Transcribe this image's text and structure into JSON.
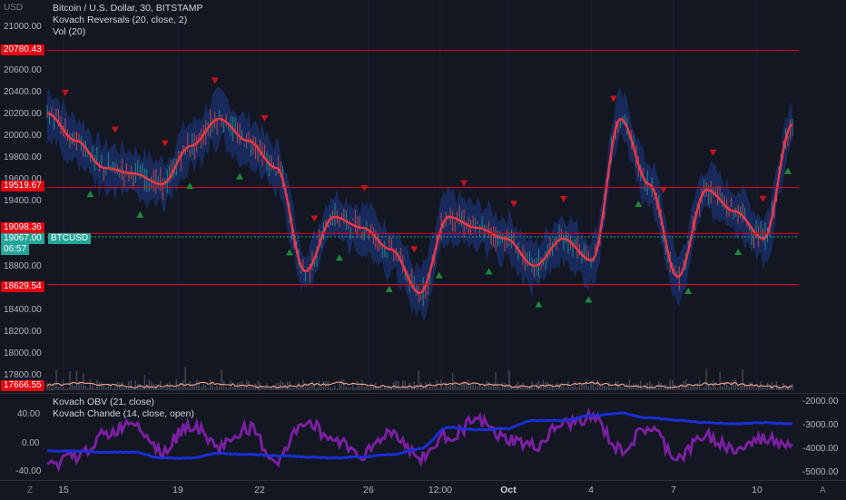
{
  "header": {
    "currency": "USD",
    "symbol_line": "Bitcoin / U.S. Dollar, 30, BITSTAMP",
    "indicator1": "Kovach Reversals (20, close, 2)",
    "indicator2": "Vol (20)"
  },
  "price_axis": {
    "ticks": [
      "21000.00",
      "20600.00",
      "20400.00",
      "20200.00",
      "20000.00",
      "19800.00",
      "19600.00",
      "19400.00",
      "18800.00",
      "18400.00",
      "18200.00",
      "18000.00",
      "17800.00"
    ]
  },
  "price_labels": [
    {
      "text": "20780.43",
      "color": "red"
    },
    {
      "text": "19519.67",
      "color": "red"
    },
    {
      "text": "19098.36",
      "color": "red"
    },
    {
      "text": "19067.00",
      "color": "teal"
    },
    {
      "text": "06:57",
      "color": "teal"
    },
    {
      "text": "18629.54",
      "color": "red"
    },
    {
      "text": "17666.55",
      "color": "red"
    }
  ],
  "symbol_tag": "BTCUSD",
  "sub_pane": {
    "legend1": "Kovach OBV (21, close)",
    "legend2": "Kovach Chande (14, close, open)",
    "left_ticks": [
      "40.00",
      "0.00",
      "-40.00"
    ],
    "right_ticks": [
      "-2000.00",
      "-3000.00",
      "-4000.00",
      "-5000.00"
    ]
  },
  "time_axis": {
    "ticks": [
      "15",
      "19",
      "22",
      "26",
      "12:00",
      "Oct",
      "4",
      "7",
      "10"
    ],
    "left_corner": "Z",
    "right_corner": "A"
  },
  "colors": {
    "background": "#131722",
    "level_line": "#e8000f",
    "trend_line": "#f23645",
    "band": "#1e3a8a",
    "up_arrow": "#1b8a3a",
    "down_arrow": "#c0141c",
    "obv_line": "#1a2fd6",
    "chande_line": "#7b1fa2"
  },
  "chart_data": {
    "type": "line",
    "title": "Bitcoin / U.S. Dollar, 30, BITSTAMP",
    "xlabel": "",
    "ylabel": "USD",
    "ylim": [
      17700,
      21150
    ],
    "x": [
      "15",
      "",
      "",
      "",
      "19",
      "",
      "",
      "22",
      "",
      "",
      "",
      "26",
      "",
      "12:00",
      "",
      "",
      "Oct",
      "",
      "",
      "4",
      "",
      "",
      "7",
      "",
      "",
      "10",
      ""
    ],
    "series": [
      {
        "name": "",
        "values": [
          20200,
          19950,
          19700,
          19650,
          19550,
          19900,
          20150,
          19950,
          19700,
          18750,
          19250,
          19150,
          18950,
          18550,
          19250,
          19150,
          19050,
          18800,
          19050,
          18850,
          20150,
          19550,
          18700,
          19500,
          19300,
          19050,
          20100
        ]
      }
    ],
    "levels": [
      20780.43,
      19519.67,
      19098.36,
      19067.0,
      18629.54,
      17666.55
    ]
  }
}
